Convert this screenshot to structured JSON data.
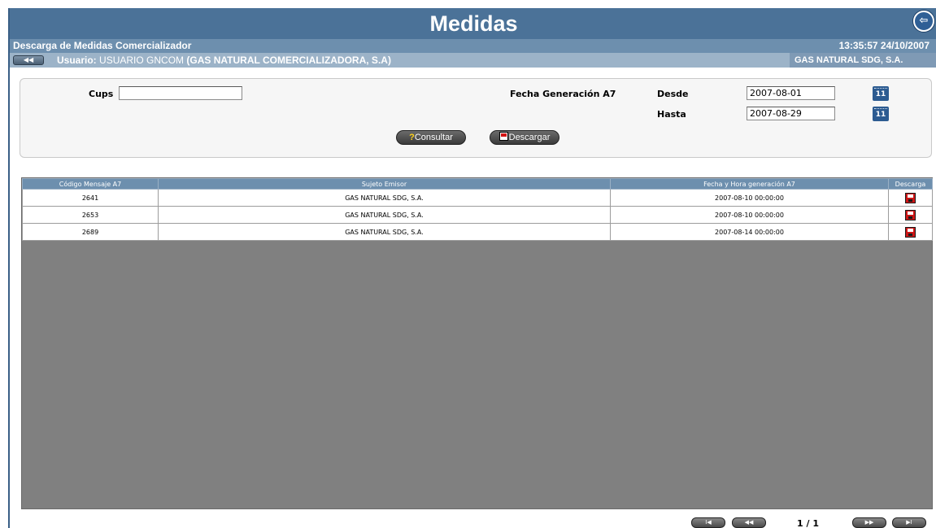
{
  "header": {
    "title": "Medidas",
    "exit_icon": "exit-icon"
  },
  "subheader": {
    "section": "Descarga de Medidas Comercializador",
    "datetime": "13:35:57 24/10/2007",
    "user_label": "Usuario:",
    "user_name": "USUARIO GNCOM",
    "user_company": "(GAS NATURAL COMERCIALIZADORA, S.A)",
    "company_box": "GAS NATURAL SDG, S.A."
  },
  "filters": {
    "cups_label": "Cups",
    "cups_value": "",
    "fecha_label": "Fecha Generación A7",
    "desde_label": "Desde",
    "desde_value": "2007-08-01",
    "hasta_label": "Hasta",
    "hasta_value": "2007-08-29",
    "calendar_value": "11",
    "consultar_label": "Consultar",
    "descargar_label": "Descargar"
  },
  "table": {
    "columns": [
      "Código Mensaje A7",
      "Sujeto Emisor",
      "Fecha y Hora generación A7",
      "Descarga"
    ],
    "rows": [
      {
        "codigo": "2641",
        "sujeto": "GAS NATURAL SDG, S.A.",
        "fecha": "2007-08-10 00:00:00"
      },
      {
        "codigo": "2653",
        "sujeto": "GAS NATURAL SDG, S.A.",
        "fecha": "2007-08-10 00:00:00"
      },
      {
        "codigo": "2689",
        "sujeto": "GAS NATURAL SDG, S.A.",
        "fecha": "2007-08-14 00:00:00"
      }
    ]
  },
  "pager": {
    "page_text": "1 / 1",
    "first": "I◀",
    "prev": "◀◀",
    "next": "▶▶",
    "last": "▶I"
  },
  "colors": {
    "title_bar": "#4b7298",
    "sub_bar": "#6d8fae",
    "user_bar": "#9cb3c8",
    "grid_bg": "#808080",
    "download_red": "#cf1515"
  }
}
